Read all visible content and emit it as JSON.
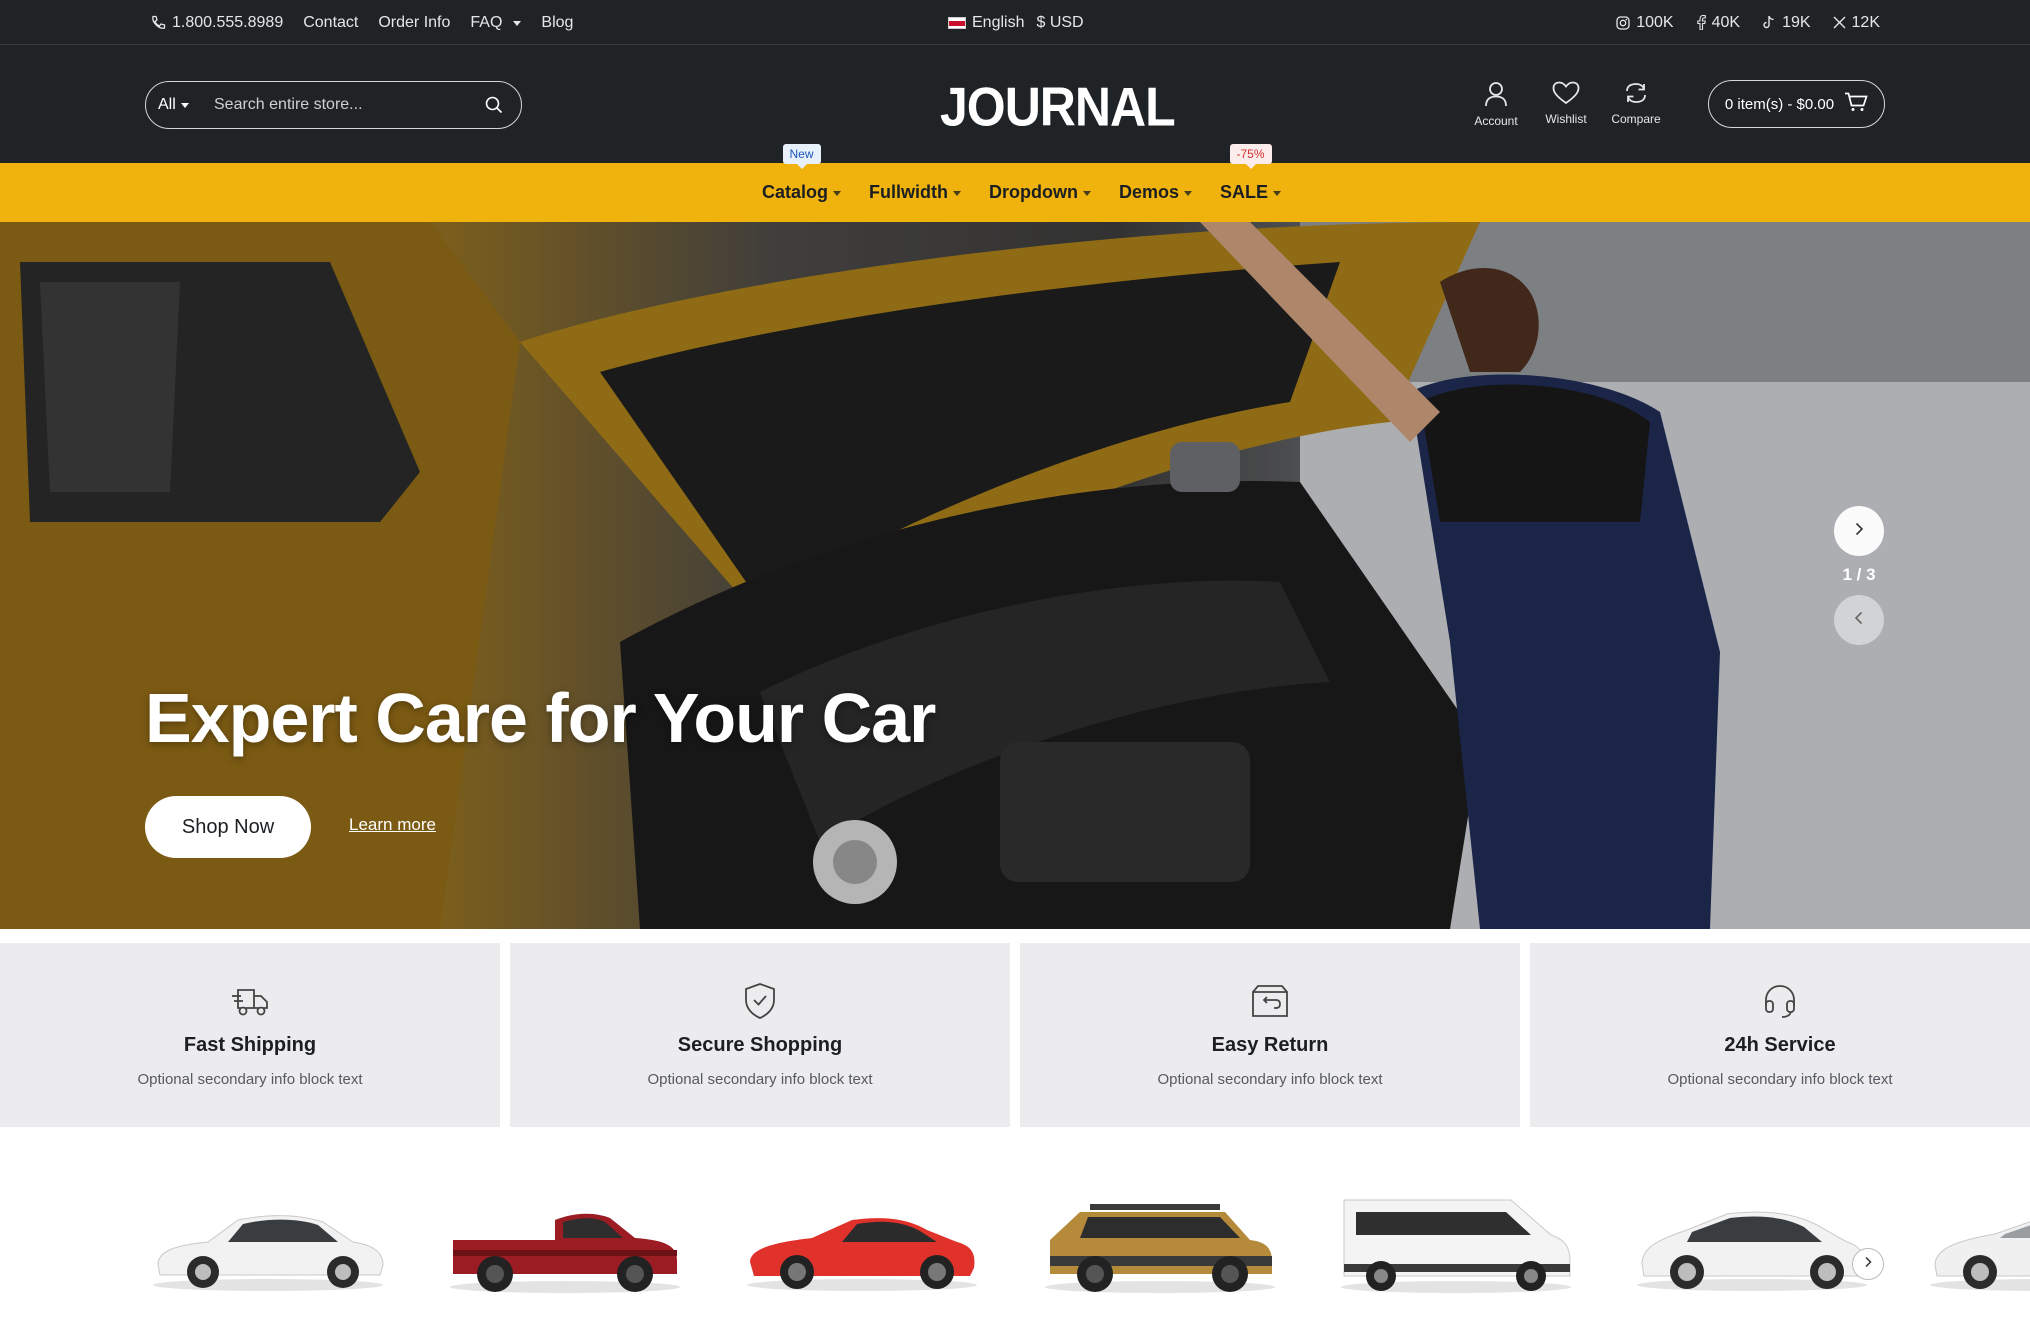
{
  "topbar": {
    "phone": "1.800.555.8989",
    "links": [
      "Contact",
      "Order Info",
      "FAQ",
      "Blog"
    ],
    "language": "English",
    "currency": "$ USD",
    "social": [
      {
        "icon": "instagram-icon",
        "count": "100K"
      },
      {
        "icon": "facebook-icon",
        "count": "40K"
      },
      {
        "icon": "tiktok-icon",
        "count": "19K"
      },
      {
        "icon": "x-icon",
        "count": "12K"
      }
    ]
  },
  "header": {
    "search_category": "All",
    "search_placeholder": "Search entire store...",
    "logo": "JOURNAL",
    "account_label": "Account",
    "wishlist_label": "Wishlist",
    "compare_label": "Compare",
    "cart_label": "0 item(s) - $0.00"
  },
  "nav": {
    "items": [
      {
        "label": "Catalog",
        "badge": "New"
      },
      {
        "label": "Fullwidth",
        "badge": ""
      },
      {
        "label": "Dropdown",
        "badge": ""
      },
      {
        "label": "Demos",
        "badge": ""
      },
      {
        "label": "SALE",
        "badge": "-75%"
      }
    ]
  },
  "hero": {
    "title": "Expert Care for Your Car",
    "primary_button": "Shop Now",
    "secondary_link": "Learn more",
    "slide_counter": "1 / 3"
  },
  "info_blocks": [
    {
      "icon": "truck-icon",
      "title": "Fast Shipping",
      "text": "Optional secondary info block text"
    },
    {
      "icon": "shield-check-icon",
      "title": "Secure Shopping",
      "text": "Optional secondary info block text"
    },
    {
      "icon": "return-box-icon",
      "title": "Easy Return",
      "text": "Optional secondary info block text"
    },
    {
      "icon": "headset-icon",
      "title": "24h Service",
      "text": "Optional secondary info block text"
    }
  ],
  "categories": [
    {
      "icon": "sedan-icon",
      "color": "#f2f2f2"
    },
    {
      "icon": "pickup-truck-icon",
      "color": "#9b1c22"
    },
    {
      "icon": "coupe-icon",
      "color": "#e0322a"
    },
    {
      "icon": "suv-icon",
      "color": "#b58a3a"
    },
    {
      "icon": "van-icon",
      "color": "#f4f4f4"
    },
    {
      "icon": "hatchback-icon",
      "color": "#f2f2f2"
    },
    {
      "icon": "sedan-partial-icon",
      "color": "#f2f2f2"
    }
  ],
  "colors": {
    "dark": "#1f2326",
    "accent": "#f0b30d",
    "info_bg": "#ececee"
  }
}
